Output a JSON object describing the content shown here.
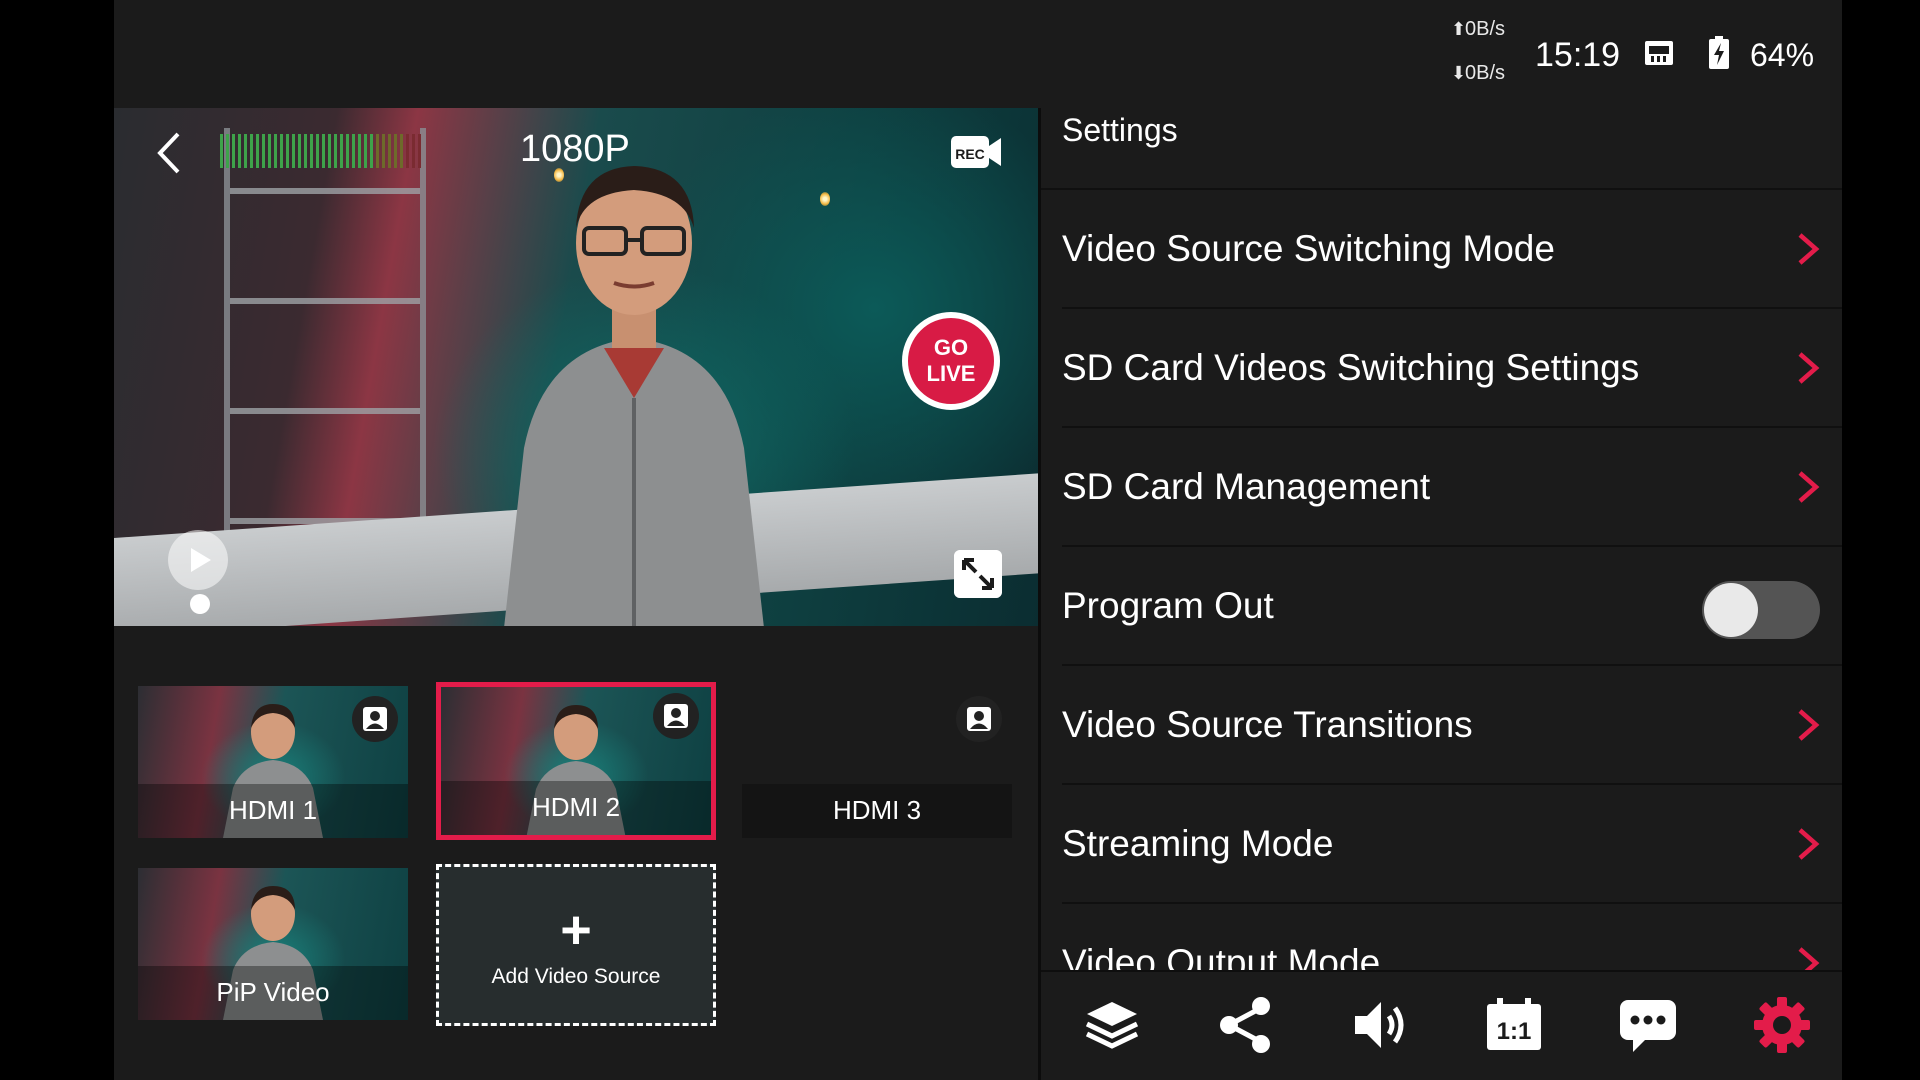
{
  "status_bar": {
    "upload_speed": "0B/s",
    "download_speed": "0B/s",
    "time": "15:19",
    "battery": "64%"
  },
  "preview": {
    "resolution": "1080P",
    "go_live_line1": "GO",
    "go_live_line2": "LIVE",
    "icons": [
      "back-icon",
      "audio-level-meter",
      "rec-camera-icon",
      "play-icon",
      "fullscreen-icon"
    ]
  },
  "sources": {
    "tiles": [
      {
        "name": "HDMI 1",
        "selected": false
      },
      {
        "name": "HDMI 2",
        "selected": true
      },
      {
        "name": "HDMI 3",
        "selected": false
      },
      {
        "name": "PiP Video",
        "selected": false
      }
    ],
    "add_label": "Add Video Source"
  },
  "settings": {
    "title": "Settings",
    "items": [
      {
        "label": "Video Source Switching Mode",
        "control": "chevron"
      },
      {
        "label": "SD Card Videos Switching Settings",
        "control": "chevron"
      },
      {
        "label": "SD Card Management",
        "control": "chevron"
      },
      {
        "label": "Program Out",
        "control": "toggle",
        "on": false
      },
      {
        "label": "Video Source Transitions",
        "control": "chevron"
      },
      {
        "label": "Streaming Mode",
        "control": "chevron"
      },
      {
        "label": "Video Output Mode",
        "control": "chevron"
      }
    ]
  },
  "toolbar": {
    "items": [
      "layers-icon",
      "share-icon",
      "volume-icon",
      "aspect-ratio-icon",
      "chat-icon",
      "settings-gear-icon"
    ],
    "aspect_label": "1:1",
    "active": "settings-gear-icon"
  },
  "colors": {
    "accent": "#e31c4a",
    "background": "#1b1b1b",
    "divider": "#101010",
    "toggle_off": "#545454"
  }
}
